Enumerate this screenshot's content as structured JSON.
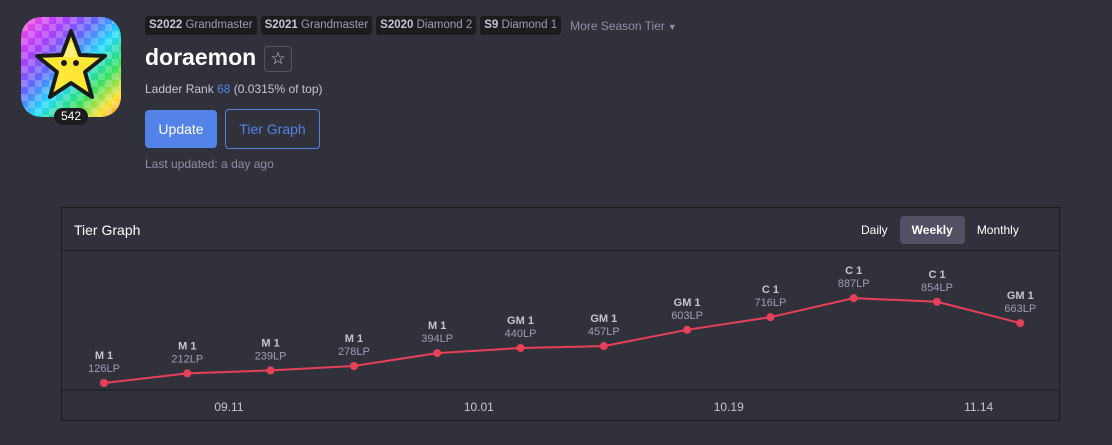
{
  "profile": {
    "level": "542",
    "name": "doraemon",
    "ladder_label": "Ladder Rank",
    "ladder_rank": "68",
    "ladder_percent": "(0.0315% of top)",
    "update_label": "Update",
    "tier_graph_label": "Tier Graph",
    "last_updated": "Last updated: a day ago"
  },
  "seasons": [
    {
      "season": "S2022",
      "tier": "Grandmaster"
    },
    {
      "season": "S2021",
      "tier": "Grandmaster"
    },
    {
      "season": "S2020",
      "tier": "Diamond 2"
    },
    {
      "season": "S9",
      "tier": "Diamond 1"
    }
  ],
  "more_season": "More Season Tier",
  "graph_panel": {
    "title": "Tier Graph",
    "tabs": [
      "Daily",
      "Weekly",
      "Monthly"
    ],
    "active_tab": "Weekly"
  },
  "colors": {
    "accent": "#5383e8",
    "line": "#e84057",
    "background": "#31313c",
    "dark": "#1c1c1f"
  },
  "icons": [
    "star-icon",
    "chevron-down-icon",
    "avatar-star-icon"
  ],
  "chart_data": {
    "type": "line",
    "x_ticks": [
      "09.11",
      "10.01",
      "10.19",
      "11.14"
    ],
    "points": [
      {
        "tier": "M 1",
        "lp": "126LP",
        "value": 126
      },
      {
        "tier": "M 1",
        "lp": "212LP",
        "value": 212
      },
      {
        "tier": "M 1",
        "lp": "239LP",
        "value": 239
      },
      {
        "tier": "M 1",
        "lp": "278LP",
        "value": 278
      },
      {
        "tier": "M 1",
        "lp": "394LP",
        "value": 394
      },
      {
        "tier": "GM 1",
        "lp": "440LP",
        "value": 440
      },
      {
        "tier": "GM 1",
        "lp": "457LP",
        "value": 457
      },
      {
        "tier": "GM 1",
        "lp": "603LP",
        "value": 603
      },
      {
        "tier": "C 1",
        "lp": "716LP",
        "value": 716
      },
      {
        "tier": "C 1",
        "lp": "887LP",
        "value": 887
      },
      {
        "tier": "C 1",
        "lp": "854LP",
        "value": 854
      },
      {
        "tier": "GM 1",
        "lp": "663LP",
        "value": 663
      }
    ]
  }
}
